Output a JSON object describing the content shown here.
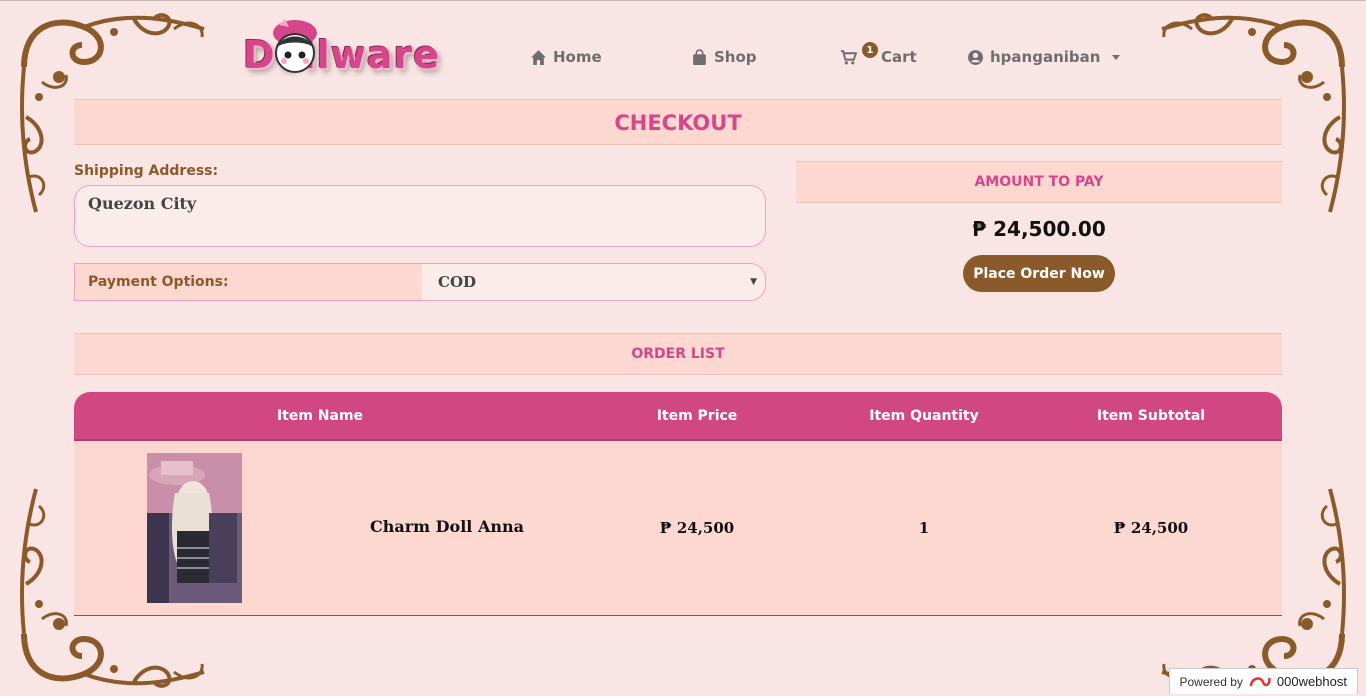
{
  "brand": {
    "logo_text": "Dollware"
  },
  "nav": {
    "home": "Home",
    "shop": "Shop",
    "cart": "Cart",
    "cart_count": "1",
    "user": "hpanganiban"
  },
  "checkout": {
    "title": "CHECKOUT",
    "shipping_label": "Shipping Address:",
    "shipping_value": "Quezon City",
    "payment_label": "Payment Options:",
    "payment_value": "COD"
  },
  "amount": {
    "title": "AMOUNT TO PAY",
    "value": "₱ 24,500.00",
    "button": "Place Order Now"
  },
  "order_list": {
    "title": "ORDER LIST",
    "columns": [
      "Item Name",
      "Item Price",
      "Item Quantity",
      "Item Subtotal"
    ],
    "rows": [
      {
        "name": "Charm Doll Anna",
        "price": "₱ 24,500",
        "quantity": "1",
        "subtotal": "₱ 24,500"
      }
    ]
  },
  "footer": {
    "powered_by": "Powered by",
    "host": "000webhost"
  },
  "colors": {
    "accent": "#d14782",
    "brown": "#8b5a2b",
    "band": "#fdd8d0",
    "background": "#f9e6e4"
  }
}
